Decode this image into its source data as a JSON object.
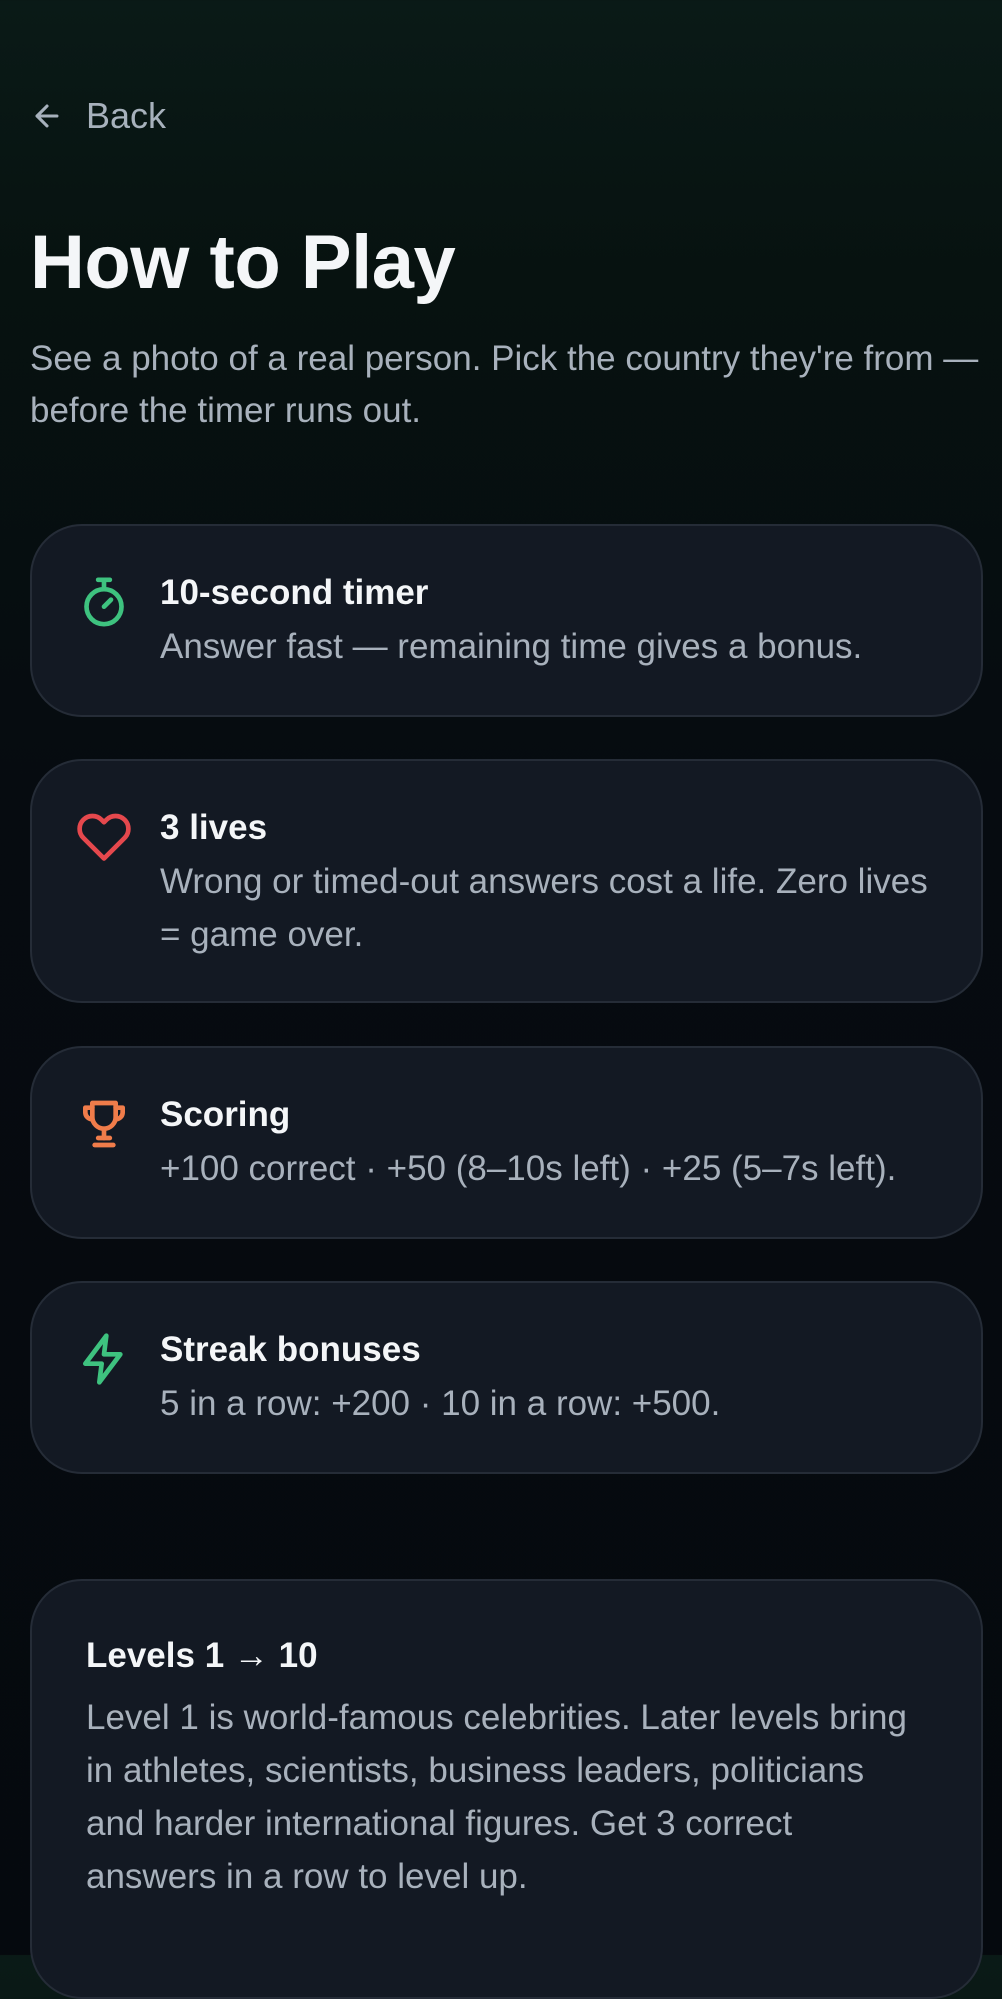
{
  "nav": {
    "back_label": "Back",
    "back_icon": "arrow-left-icon"
  },
  "header": {
    "title": "How to Play",
    "description": "See a photo of a real person. Pick the country they're from — before the timer runs out."
  },
  "rules": [
    {
      "icon": "stopwatch-icon",
      "icon_color": "#3ec27f",
      "title": "10-second timer",
      "description": "Answer fast — remaining time gives a bonus."
    },
    {
      "icon": "heart-icon",
      "icon_color": "#e5484d",
      "title": "3 lives",
      "description": "Wrong or timed-out answers cost a life. Zero lives = game over."
    },
    {
      "icon": "trophy-icon",
      "icon_color": "#f07c4a",
      "title": "Scoring",
      "description": "+100 correct · +50 (8–10s left) · +25 (5–7s left)."
    },
    {
      "icon": "lightning-icon",
      "icon_color": "#3ec27f",
      "title": "Streak bonuses",
      "description": "5 in a row: +200 · 10 in a row: +500."
    }
  ],
  "levels": {
    "title": "Levels 1 → 10",
    "description": "Level 1 is world-famous celebrities. Later levels bring in athletes, scientists, business leaders, politicians and harder international figures. Get 3 correct answers in a row to level up."
  },
  "colors": {
    "background": "#05090e",
    "card": "#131923",
    "card_border": "#252c37",
    "text_primary": "#f4f6f8",
    "text_secondary": "#a8b1bc"
  }
}
